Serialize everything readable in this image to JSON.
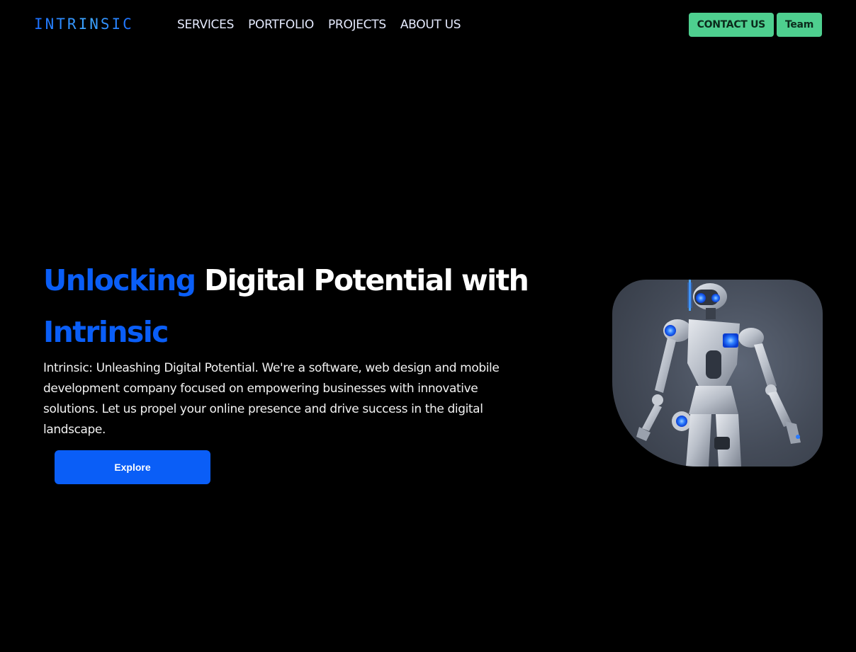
{
  "header": {
    "logo": "INTRINSIC",
    "nav": [
      {
        "label": "SERVICES"
      },
      {
        "label": "PORTFOLIO"
      },
      {
        "label": "PROJECTS"
      },
      {
        "label": "ABOUT US"
      }
    ],
    "contact_label": "CONTACT US",
    "team_label": "Team"
  },
  "hero": {
    "title_accent": "Unlocking",
    "title_rest": "Digital Potential with",
    "title_brand": "Intrinsic",
    "description": "Intrinsic: Unleashing Digital Potential. We're a software, web design and mobile development company focused on empowering businesses with innovative solutions. Let us propel your online presence and drive success in the digital landscape.",
    "cta_label": "Explore",
    "image_subject": "robot-illustration"
  },
  "colors": {
    "background": "#000000",
    "accent_blue": "#0a5ef7",
    "logo_blue": "#1e8fff",
    "button_green": "#4ecf8f",
    "text_white": "#ffffff"
  }
}
